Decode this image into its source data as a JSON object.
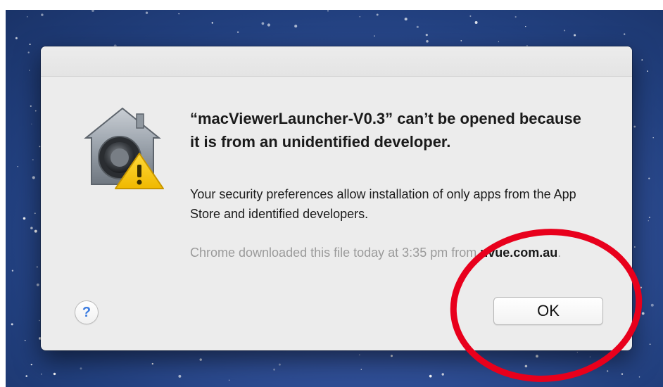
{
  "dialog": {
    "title": "“macViewerLauncher-V0.3” can’t be opened because it is from an unidentified developer.",
    "message": "Your security preferences allow installation of only apps from the App Store and identified developers.",
    "source_prefix": "Chrome downloaded this file today at 3:35 pm from",
    "source_domain": "uvue.com.au",
    "source_suffix": ".",
    "help_label": "?",
    "ok_label": "OK",
    "icon": "gatekeeper-warning-icon"
  },
  "colors": {
    "desktop_blue": "#2c4a8e",
    "dialog_bg": "#ececec",
    "help_blue": "#3a7be0",
    "warning_yellow": "#f2c200",
    "annotation_red": "#e8001c"
  }
}
